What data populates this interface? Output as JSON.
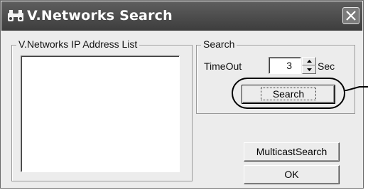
{
  "window": {
    "title": "V.Networks Search",
    "title_icon": "binoculars-icon",
    "close_icon": "close-icon"
  },
  "ip_list": {
    "group_label": "V.Networks IP Address List",
    "items": []
  },
  "search": {
    "group_label": "Search",
    "timeout_label": "TimeOut",
    "timeout_value": "3",
    "unit_label": "Sec",
    "search_button": "Search"
  },
  "buttons": {
    "multicast": "MulticastSearch",
    "ok": "OK"
  }
}
